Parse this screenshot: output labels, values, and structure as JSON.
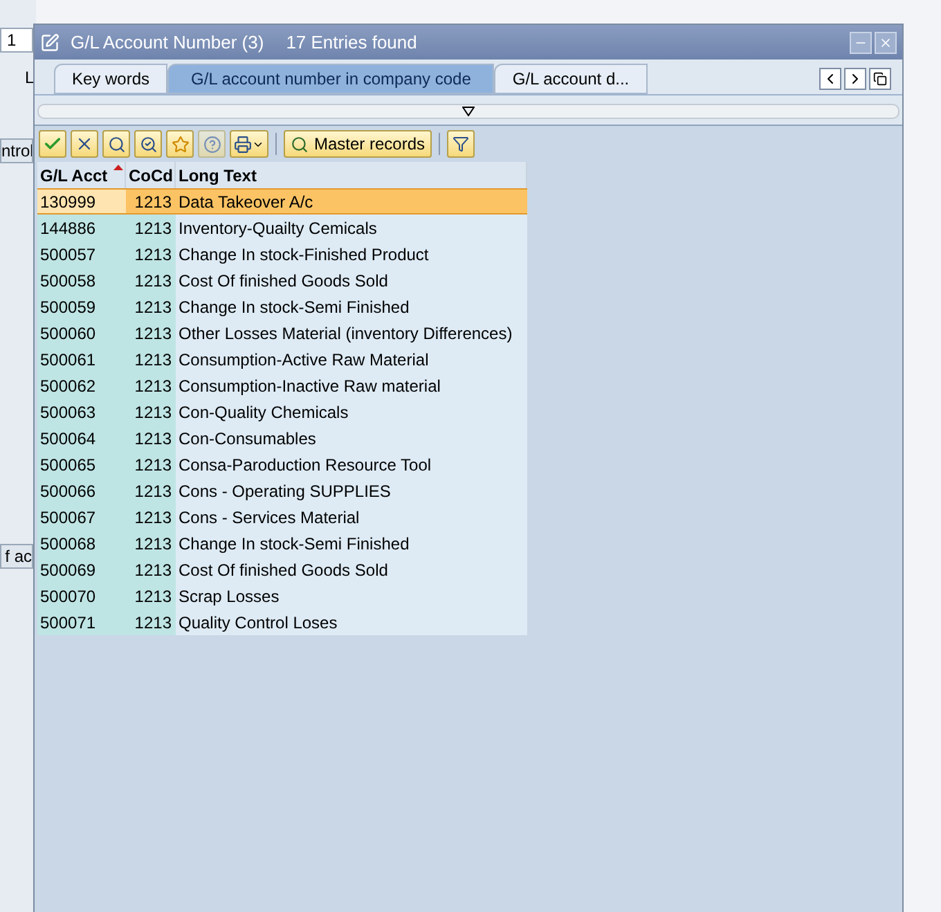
{
  "background": {
    "fragments": [
      {
        "text": "1",
        "kind": "field"
      },
      {
        "text": "L",
        "kind": "label"
      },
      {
        "text": "ntrol",
        "kind": "button"
      },
      {
        "text": "f ac",
        "kind": "button"
      }
    ]
  },
  "window": {
    "title": "G/L Account Number (3)",
    "subtitle": "17 Entries found"
  },
  "tabs": [
    {
      "label": "Key words",
      "selected": false
    },
    {
      "label": "G/L account number in company code",
      "selected": true
    },
    {
      "label": "G/L account d...",
      "selected": false
    }
  ],
  "toolbar": {
    "master_records": "Master records"
  },
  "table": {
    "columns": [
      {
        "label": "G/L Acct",
        "sorted": true
      },
      {
        "label": "CoCd",
        "sorted": false
      },
      {
        "label": "Long Text",
        "sorted": false
      }
    ],
    "rows": [
      {
        "cells": [
          "130999",
          "1213",
          "Data Takeover A/c"
        ],
        "selected": true
      },
      {
        "cells": [
          "144886",
          "1213",
          "Inventory-Quailty Cemicals"
        ],
        "selected": false
      },
      {
        "cells": [
          "500057",
          "1213",
          "Change In stock-Finished Product"
        ],
        "selected": false
      },
      {
        "cells": [
          "500058",
          "1213",
          "Cost Of finished Goods Sold"
        ],
        "selected": false
      },
      {
        "cells": [
          "500059",
          "1213",
          "Change In stock-Semi Finished"
        ],
        "selected": false
      },
      {
        "cells": [
          "500060",
          "1213",
          "Other Losses Material (inventory Differences)"
        ],
        "selected": false
      },
      {
        "cells": [
          "500061",
          "1213",
          "Consumption-Active Raw Material"
        ],
        "selected": false
      },
      {
        "cells": [
          "500062",
          "1213",
          "Consumption-Inactive Raw material"
        ],
        "selected": false
      },
      {
        "cells": [
          "500063",
          "1213",
          "Con-Quality Chemicals"
        ],
        "selected": false
      },
      {
        "cells": [
          "500064",
          "1213",
          "Con-Consumables"
        ],
        "selected": false
      },
      {
        "cells": [
          "500065",
          "1213",
          "Consa-Paroduction Resource Tool"
        ],
        "selected": false
      },
      {
        "cells": [
          "500066",
          "1213",
          "Cons - Operating SUPPLIES"
        ],
        "selected": false
      },
      {
        "cells": [
          "500067",
          "1213",
          "Cons - Services Material"
        ],
        "selected": false
      },
      {
        "cells": [
          "500068",
          "1213",
          "Change In stock-Semi Finished"
        ],
        "selected": false
      },
      {
        "cells": [
          "500069",
          "1213",
          "Cost Of finished Goods Sold"
        ],
        "selected": false
      },
      {
        "cells": [
          "500070",
          "1213",
          "Scrap Losses"
        ],
        "selected": false
      },
      {
        "cells": [
          "500071",
          "1213",
          "Quality Control Loses"
        ],
        "selected": false
      }
    ]
  }
}
